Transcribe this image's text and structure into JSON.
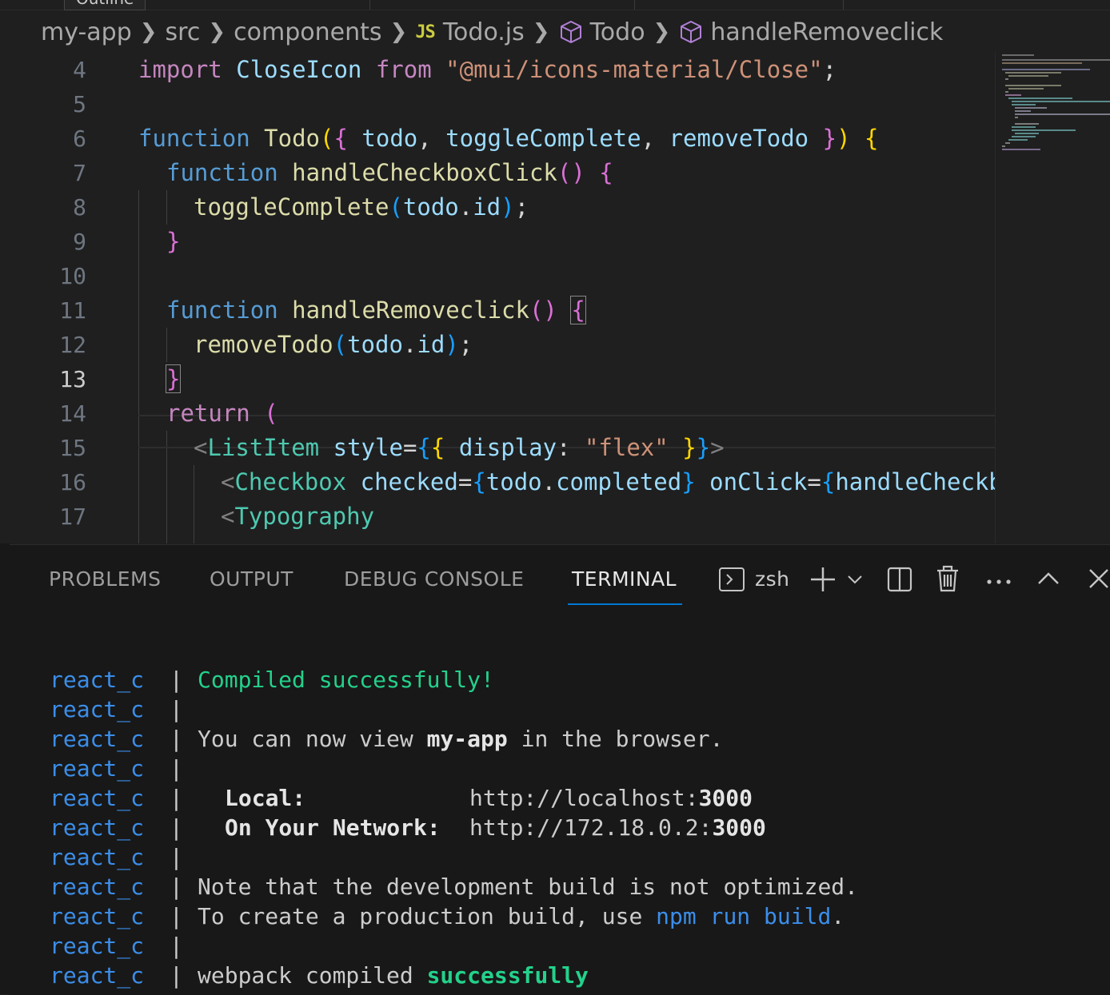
{
  "top_tooltip": "Outline",
  "breadcrumb": {
    "items": [
      "my-app",
      "src",
      "components"
    ],
    "file_badge": "JS",
    "file_name": "Todo.js",
    "symbol1": "Todo",
    "symbol2": "handleRemoveclick"
  },
  "editor": {
    "active_line": "13",
    "line_numbers": [
      "4",
      "5",
      "6",
      "7",
      "8",
      "9",
      "10",
      "11",
      "12",
      "13",
      "14",
      "15",
      "16",
      "17"
    ]
  },
  "panel": {
    "tabs": [
      "PROBLEMS",
      "OUTPUT",
      "DEBUG CONSOLE",
      "TERMINAL"
    ],
    "active_tab": "TERMINAL",
    "shell_name": "zsh"
  },
  "terminal": {
    "prefix": "react_c",
    "separator": "|",
    "compiled": "Compiled successfully!",
    "view_pre": "You can now view ",
    "view_app": "my-app",
    "view_post": " in the browser.",
    "local_label": "Local:",
    "local_url_pre": "http://localhost:",
    "local_port": "3000",
    "net_label": "On Your Network:",
    "net_url_pre": "http://172.18.0.2:",
    "net_port": "3000",
    "note": "Note that the development build is not optimized.",
    "create_pre": "To create a production build, use ",
    "create_cmd": "npm run build",
    "create_post": ".",
    "webpack_pre": "webpack compiled ",
    "webpack_status": "successfully"
  }
}
